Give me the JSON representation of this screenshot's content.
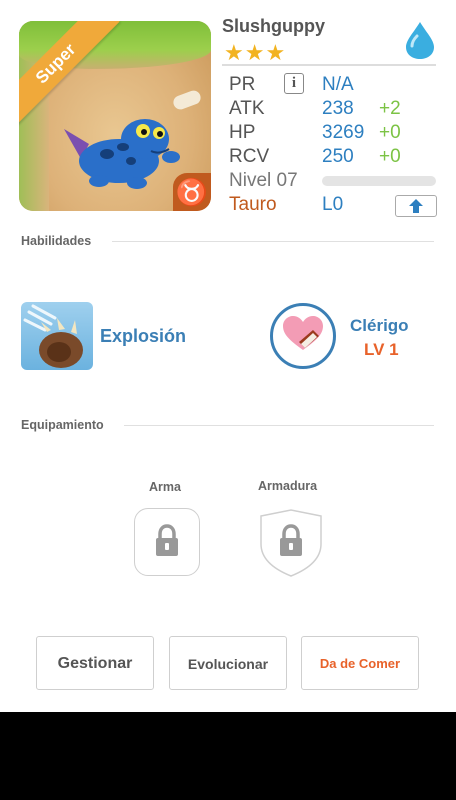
{
  "creature": {
    "name": "Slushguppy",
    "stars": "★★★",
    "badge": "Super",
    "zodiac_symbol": "♉"
  },
  "stats": {
    "pr_label": "PR",
    "pr_info": "i",
    "pr_value": "N/A",
    "atk_label": "ATK",
    "atk_value": "238",
    "atk_bonus": "+2",
    "hp_label": "HP",
    "hp_value": "3269",
    "hp_bonus": "+0",
    "rcv_label": "RCV",
    "rcv_value": "250",
    "rcv_bonus": "+0",
    "level_label": "Nivel 07",
    "level_progress": 0,
    "zodiac_label": "Tauro",
    "zodiac_level": "L0"
  },
  "skills": {
    "title": "Habilidades",
    "active_name": "Explosión",
    "leader_name": "Clérigo",
    "leader_level": "LV 1"
  },
  "equipment": {
    "title": "Equipamiento",
    "weapon_label": "Arma",
    "armor_label": "Armadura"
  },
  "buttons": {
    "manage": "Gestionar",
    "evolve": "Evolucionar",
    "feed": "Da de Comer"
  },
  "colors": {
    "accent_blue": "#2d7fc0",
    "bonus_green": "#7cc345",
    "feed_orange": "#e8622a",
    "zodiac_brown": "#c05a1e",
    "star_gold": "#f2b320"
  }
}
